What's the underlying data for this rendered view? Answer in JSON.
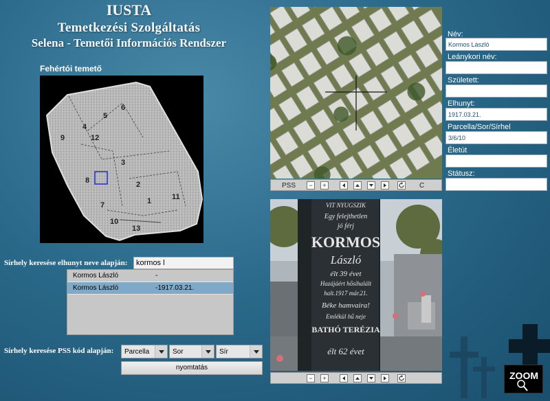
{
  "header": {
    "line1": "IUSTA",
    "line2": "Temetkezési Szolgáltatás",
    "line3": "Selena - Temetői Információs Rendszer"
  },
  "map": {
    "title": "Fehértói temető",
    "plot_numbers": [
      "6",
      "5",
      "4",
      "12",
      "9",
      "3",
      "8",
      "2",
      "7",
      "1",
      "11",
      "10",
      "13"
    ]
  },
  "search_by_name": {
    "label": "Sírhely keresése elhunyt neve alapján:",
    "value": "kormos l",
    "results": [
      {
        "name": "Kormos László",
        "dates": "-"
      },
      {
        "name": "Kormos László",
        "dates": "-1917.03.21."
      }
    ],
    "selected_index": 1
  },
  "search_by_code": {
    "label": "Sírhely keresése  PSS kód alapján:",
    "dropdowns": [
      "Parcella",
      "Sor",
      "Sír"
    ],
    "print_label": "nyomtatás"
  },
  "aerial_toolbar": {
    "label": "PSS",
    "zoom_out": "−",
    "zoom_in": "+",
    "right_label": "C"
  },
  "photo_toolbar": {
    "zoom_out": "−",
    "zoom_in": "+"
  },
  "tombstone_text": [
    "VIT NYUGSZIK",
    "Egy felejthetlen",
    "jó férj",
    "KORMOS",
    "László",
    "élt 39 évet",
    "Hazájáért hősihalált",
    "halt.1917 már.21.",
    "Béke hamvaira!",
    "Emlékül hű neje",
    "BATHÓ TERÉZIA",
    "élt 62 évet"
  ],
  "details": {
    "fields": [
      {
        "label": "Név:",
        "value": "Kormos László"
      },
      {
        "label": "Leánykori név:",
        "value": ""
      },
      {
        "label": "Született:",
        "value": ""
      },
      {
        "label": "Elhunyt:",
        "value": "1917.03.21."
      },
      {
        "label": "Parcella/Sor/Sírhel",
        "value": "3/6/10"
      },
      {
        "label": "Életút",
        "value": ""
      },
      {
        "label": "Státusz:",
        "value": ""
      }
    ]
  },
  "logo": {
    "text": "ZOOM"
  },
  "colors": {
    "background": "#2b6a8b",
    "selected_row": "#7fa9c8"
  }
}
